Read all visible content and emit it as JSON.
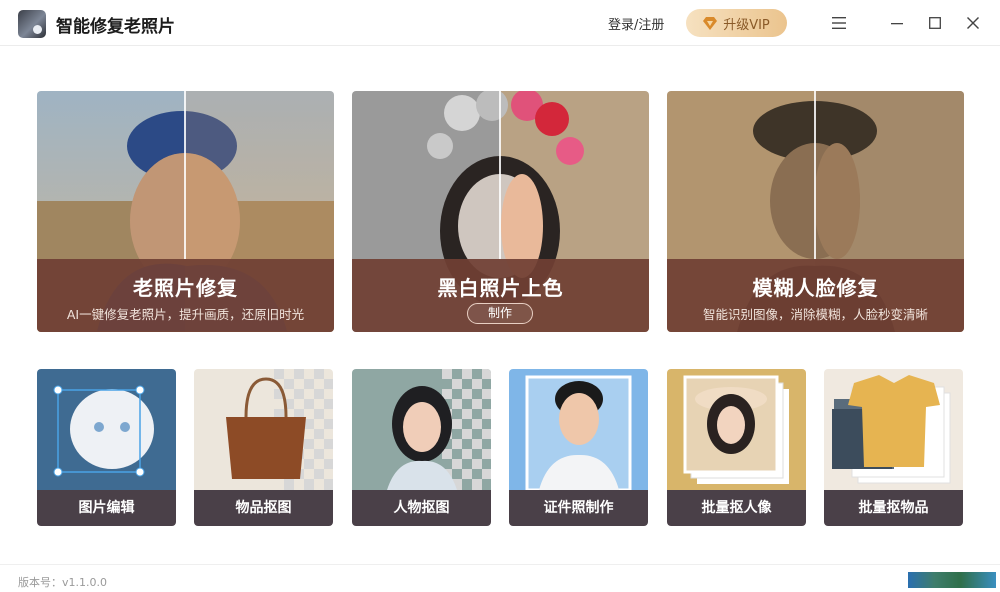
{
  "app": {
    "title": "智能修复老照片",
    "logo_icon": "app-logo-icon"
  },
  "header": {
    "login_label": "登录/注册",
    "vip_label": "升级VIP",
    "vip_icon": "diamond-icon"
  },
  "window_controls": [
    "menu-icon",
    "minimize-icon",
    "maximize-icon",
    "close-icon"
  ],
  "features": [
    {
      "title": "老照片修复",
      "subtitle": "AI一键修复老照片，提升画质，还原旧时光"
    },
    {
      "title": "黑白照片上色",
      "button": "制作"
    },
    {
      "title": "模糊人脸修复",
      "subtitle": "智能识别图像，消除模糊，人脸秒变清晰"
    }
  ],
  "tools": [
    {
      "label": "图片编辑"
    },
    {
      "label": "物品抠图"
    },
    {
      "label": "人物抠图"
    },
    {
      "label": "证件照制作"
    },
    {
      "label": "批量抠人像"
    },
    {
      "label": "批量抠物品"
    }
  ],
  "footer": {
    "version": "版本号：v1.1.0.0"
  },
  "colors": {
    "band": "#703f34",
    "tool_band": "#4a4048",
    "vip_start": "#f6e1c0",
    "vip_end": "#ebc48e"
  }
}
